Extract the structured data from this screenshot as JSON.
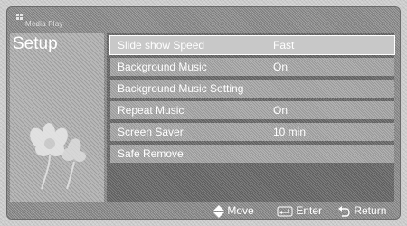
{
  "header": {
    "brand": "Media Play"
  },
  "panel": {
    "title": "Setup"
  },
  "menu": [
    {
      "label": "Slide show Speed",
      "value": "Fast",
      "selected": true
    },
    {
      "label": "Background Music",
      "value": "On"
    },
    {
      "label": "Background Music Setting",
      "value": ""
    },
    {
      "label": "Repeat Music",
      "value": "On"
    },
    {
      "label": "Screen Saver",
      "value": "10 min"
    },
    {
      "label": "Safe Remove",
      "value": ""
    }
  ],
  "footer": {
    "move": "Move",
    "enter": "Enter",
    "return": "Return"
  },
  "icons": {
    "move": "updown-arrows-icon",
    "enter": "enter-icon",
    "return": "return-icon"
  }
}
